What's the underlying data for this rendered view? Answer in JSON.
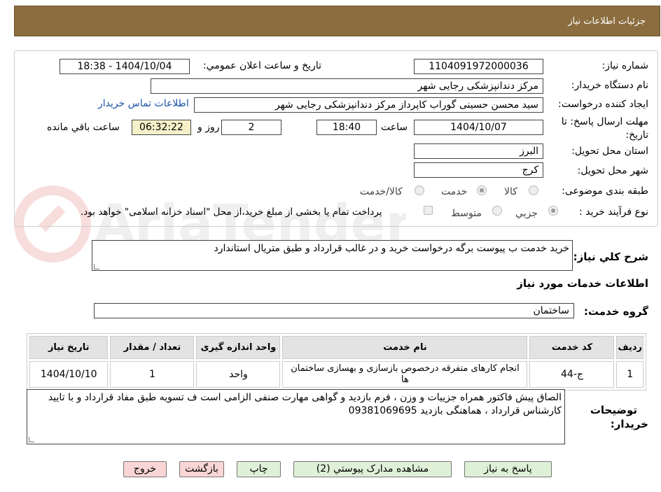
{
  "header": {
    "title": "جزئیات اطلاعات نیاز"
  },
  "form": {
    "need_number_label": "شماره نیاز:",
    "need_number": "1104091972000036",
    "announce_label": "تاریخ و ساعت اعلان عمومي:",
    "announce_value": "1404/10/04 - 18:38",
    "buyer_org_label": "نام دستگاه خریدار:",
    "buyer_org": "مرکز دندانپزشکی رجایی شهر",
    "requester_label": "ایجاد کننده درخواست:",
    "requester": "سید محسن  حسینی گوراب کاپرداز مرکز دندانپزشکی رجایی شهر",
    "contact_link": "اطلاعات تماس خریدار",
    "deadline_label_1": "مهلت ارسال پاسخ: تا",
    "deadline_label_2": "تاریخ:",
    "deadline_date": "1404/10/07",
    "time_label": "ساعت",
    "deadline_time": "18:40",
    "days_value": "2",
    "days_label": "روز و",
    "remaining_time": "06:32:22",
    "remaining_label": "ساعت باقي مانده",
    "province_label": "استان محل تحویل:",
    "province": "البرز",
    "city_label": "شهر محل تحویل:",
    "city": "کرج",
    "category_label": "طبقه بندی موضوعی:",
    "category_options": [
      "کالا",
      "خدمت",
      "کالا/خدمت"
    ],
    "category_selected": "خدمت",
    "process_label": "نوع فرآیند خرید :",
    "process_options": [
      "جزیي",
      "متوسط"
    ],
    "payment_note": "پرداخت تمام یا بخشی از مبلغ خرید،از محل \"اسناد خزانه اسلامی\" خواهد بود."
  },
  "summary": {
    "label": "شرح کلي نیاز:",
    "text": "خرید خدمت ب پیوست برگه درخواست خرید و در غالب قرارداد و طبق متریال استاندارد"
  },
  "services": {
    "section_title": "اطلاعات خدمات مورد نیاز",
    "group_label": "گروه خدمت:",
    "group_value": "ساختمان",
    "columns": [
      "ردیف",
      "کد خدمت",
      "نام خدمت",
      "واحد اندازه گیری",
      "تعداد / مقدار",
      "تاریخ نیاز"
    ],
    "rows": [
      {
        "index": "1",
        "code": "ج-44",
        "name": "انجام کارهای متفرقه درخصوص بازسازی و بهسازی ساختمان ها",
        "unit": "واحد",
        "qty": "1",
        "date": "1404/10/10"
      }
    ]
  },
  "buyer_notes": {
    "label_1": "توضیحات",
    "label_2": "خریدار:",
    "text": "الصاق پیش فاکتور همراه جزییات و وزن ، فرم بازدید و گواهی مهارت صنفی الزامی است ف تسویه طبق مفاد قرارداد و با تایید کارشناس قرارداد ، هماهنگی بازدید 09381069695"
  },
  "buttons": {
    "reply": "پاسخ به نیاز",
    "attachments": "مشاهده مدارک پیوستي (2)",
    "print": "چاپ",
    "back": "بازگشت",
    "exit": "خروج"
  },
  "watermark": {
    "text": "AriaTender.neT"
  }
}
